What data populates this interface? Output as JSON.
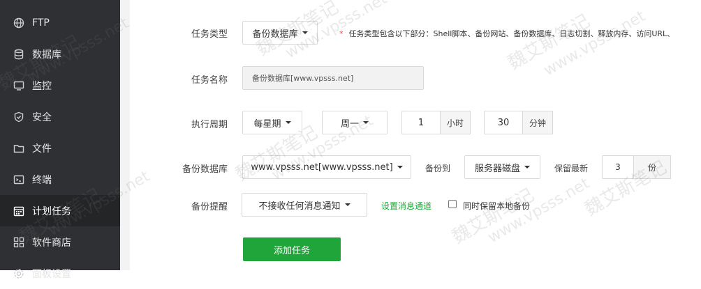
{
  "sidebar": {
    "items": [
      {
        "label": "FTP",
        "icon": "globe-icon"
      },
      {
        "label": "数据库",
        "icon": "database-icon"
      },
      {
        "label": "监控",
        "icon": "monitor-icon"
      },
      {
        "label": "安全",
        "icon": "shield-icon"
      },
      {
        "label": "文件",
        "icon": "folder-icon"
      },
      {
        "label": "终端",
        "icon": "terminal-icon"
      },
      {
        "label": "计划任务",
        "icon": "calendar-icon",
        "active": true
      },
      {
        "label": "软件商店",
        "icon": "apps-icon"
      },
      {
        "label": "面板设置",
        "icon": "settings-icon"
      }
    ]
  },
  "form": {
    "task_type": {
      "label": "任务类型",
      "value": "备份数据库",
      "hint_star": "*",
      "hint": "任务类型包含以下部分：Shell脚本、备份网站、备份数据库、日志切割、释放内存、访问URL、"
    },
    "task_name": {
      "label": "任务名称",
      "value": "备份数据库[www.vpsss.net]"
    },
    "cycle": {
      "label": "执行周期",
      "period": "每星期",
      "weekday": "周一",
      "hour": "1",
      "hour_unit": "小时",
      "minute": "30",
      "minute_unit": "分钟"
    },
    "backup_db": {
      "label": "备份数据库",
      "value": "www.vpsss.net[www.vpsss.net]",
      "backup_to_label": "备份到",
      "backup_to": "服务器磁盘",
      "keep_label": "保留最新",
      "keep_value": "3",
      "keep_unit": "份"
    },
    "notify": {
      "label": "备份提醒",
      "value": "不接收任何消息通知",
      "link": "设置消息通道",
      "checkbox_label": "同时保留本地备份",
      "checkbox_checked": false
    },
    "submit": "添加任务"
  },
  "watermark": {
    "cn": "魏艾斯笔记",
    "en": "www.vpsss.net"
  }
}
